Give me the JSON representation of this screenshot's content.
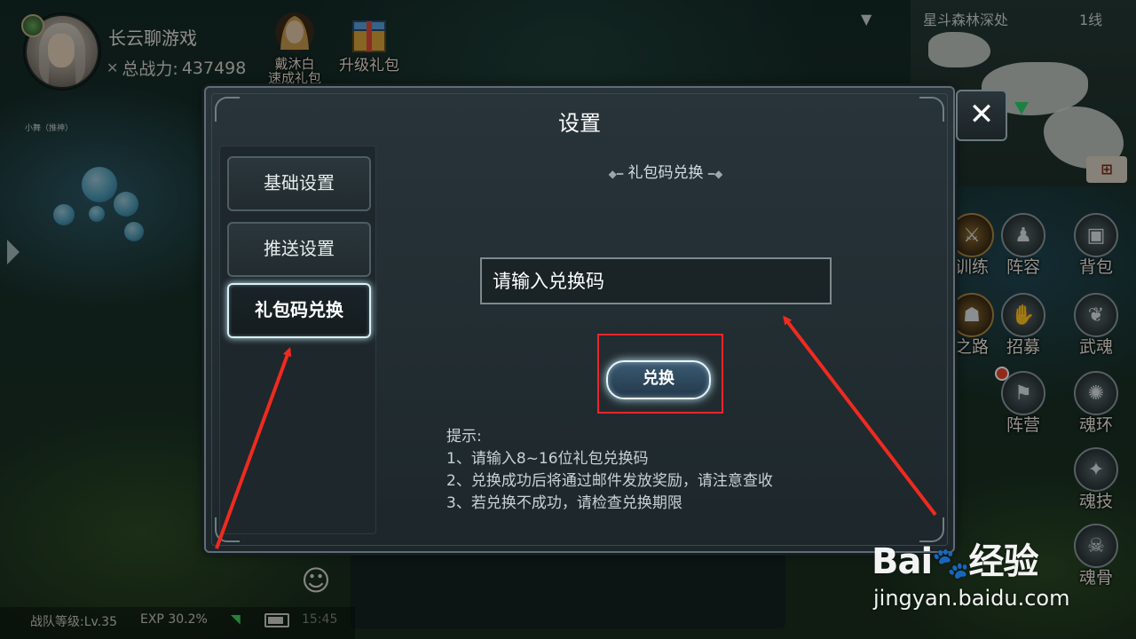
{
  "player": {
    "name": "长云聊游戏",
    "power_label": "总战力:",
    "power_value": "437498"
  },
  "top_icons": [
    {
      "label_line1": "戴沐白",
      "label_line2": "速成礼包",
      "icon": "character-portrait-icon"
    },
    {
      "label": "升级礼包",
      "icon": "gift-box-icon"
    }
  ],
  "minimap": {
    "location": "星斗森林深处",
    "line": "1线"
  },
  "npc_label": "小舞（推神）",
  "side_functions": [
    {
      "label": "训练",
      "icon": "training-icon"
    },
    {
      "label": "阵容",
      "icon": "formation-icon"
    },
    {
      "label": "背包",
      "icon": "backpack-icon"
    },
    {
      "label": "之路",
      "icon": "path-icon"
    },
    {
      "label": "招募",
      "icon": "recruit-icon"
    },
    {
      "label": "武魂",
      "icon": "martial-soul-icon"
    },
    {
      "label": "阵营",
      "icon": "camp-flag-icon"
    },
    {
      "label": "魂环",
      "icon": "soul-ring-icon"
    },
    {
      "label": "魂技",
      "icon": "soul-skill-icon"
    },
    {
      "label": "魂骨",
      "icon": "soul-bone-icon"
    }
  ],
  "status_bar": {
    "team_level": "战队等级:Lv.35",
    "exp": "EXP 30.2%",
    "clock": "15:45"
  },
  "dialog": {
    "title": "设置",
    "tabs": [
      {
        "label": "基础设置",
        "active": false
      },
      {
        "label": "推送设置",
        "active": false
      },
      {
        "label": "礼包码兑换",
        "active": true
      }
    ],
    "section_title": "礼包码兑换",
    "input_placeholder": "请输入兑换码",
    "redeem_label": "兑换",
    "tips": [
      "提示:",
      "1、请输入8~16位礼包兑换码",
      "2、兑换成功后将通过邮件发放奖励，请注意查收",
      "3、若兑换不成功，请检查兑换期限"
    ]
  },
  "watermark": {
    "brand": "Bai",
    "brand_suffix": "经验",
    "url": "jingyan.baidu.com"
  },
  "colors": {
    "annotation_red": "#e8262a",
    "active_glow": "#bfe8f4"
  }
}
